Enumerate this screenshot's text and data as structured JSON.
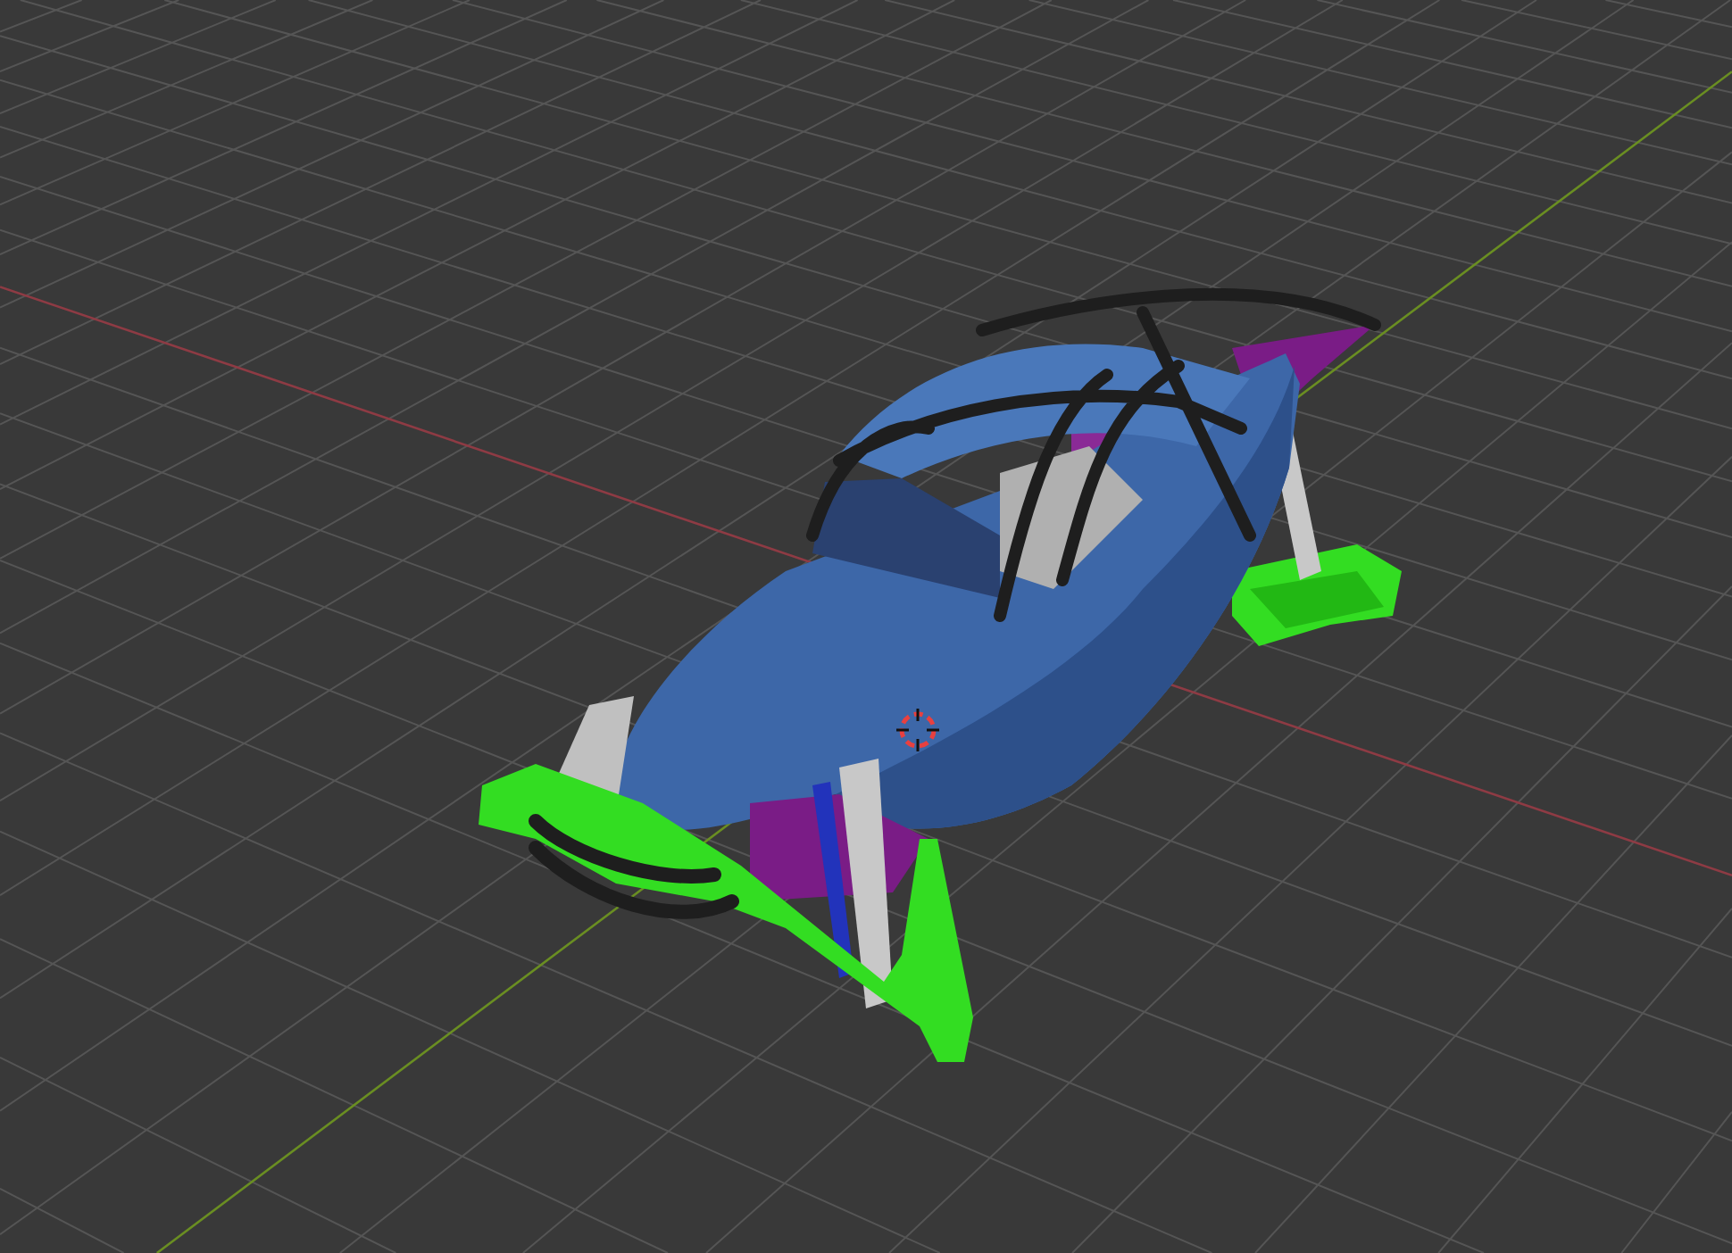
{
  "viewport": {
    "show_grid": true,
    "show_axes": true,
    "show_cursor": true
  }
}
